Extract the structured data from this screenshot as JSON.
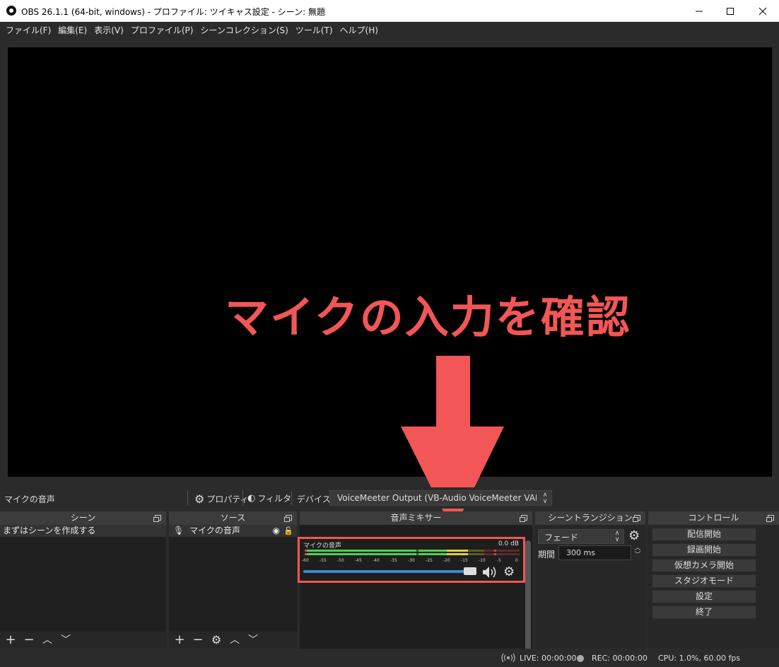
{
  "window": {
    "title": "OBS 26.1.1 (64-bit, windows) - プロファイル: ツイキャス設定 - シーン: 無題",
    "min_symbol": "—",
    "max_symbol": "☐",
    "close_symbol": "✕"
  },
  "menu": [
    "ファイル(F)",
    "編集(E)",
    "表示(V)",
    "プロファイル(P)",
    "シーンコレクション(S)",
    "ツール(T)",
    "ヘルプ(H)"
  ],
  "preview": {
    "annotation_text": "マイクの入力を確認",
    "annotation_color": "#f25656"
  },
  "source_toolbar": {
    "selected_source": "マイクの音声",
    "properties_label": "プロパティ",
    "filters_label": "フィルタ",
    "device_label": "デバイス",
    "device_value": "VoiceMeeter Output (VB-Audio VoiceMeeter VAIO)"
  },
  "docks": {
    "scenes": {
      "title": "シーン",
      "items": [
        "まずはシーンを作成する"
      ]
    },
    "sources": {
      "title": "ソース",
      "items": [
        "マイクの音声"
      ]
    },
    "mixer": {
      "title": "音声ミキサー",
      "channel_name": "マイクの音声",
      "level": "0.0 dB",
      "ticks": [
        "-60",
        "-55",
        "-50",
        "-45",
        "-40",
        "-35",
        "-30",
        "-25",
        "-20",
        "-15",
        "-10",
        "-5",
        "0"
      ],
      "volume_fraction": 1.0
    },
    "transitions": {
      "title": "シーントランジション",
      "type": "フェード",
      "duration_label": "期間",
      "duration_value": "300 ms"
    },
    "controls": {
      "title": "コントロール",
      "buttons": [
        "配信開始",
        "録画開始",
        "仮想カメラ開始",
        "スタジオモード",
        "設定",
        "終了"
      ]
    }
  },
  "status": {
    "live": "LIVE: 00:00:00",
    "rec": "REC: 00:00:00",
    "cpu": "CPU: 1.0%, 60.00 fps"
  },
  "icons": {
    "add": "+",
    "remove": "−",
    "up": "∧",
    "down": "∨",
    "gear": "⚙",
    "eye": "👁",
    "lock": "🔓"
  }
}
